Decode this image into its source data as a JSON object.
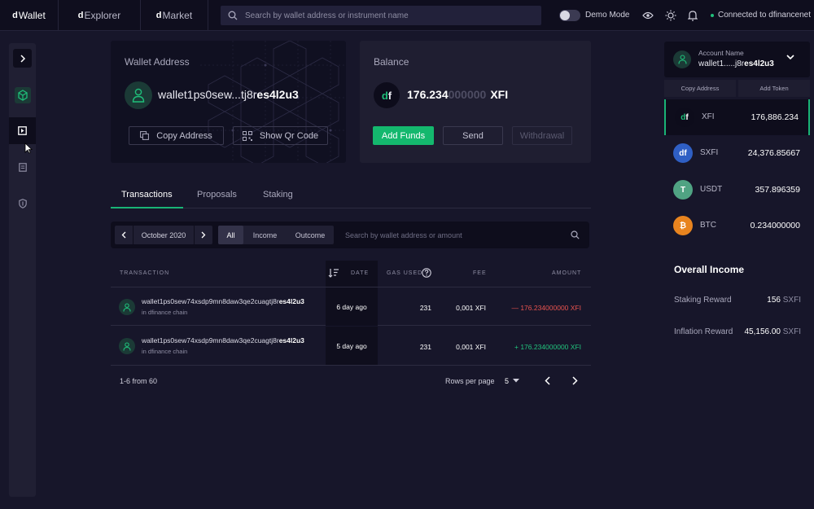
{
  "nav": {
    "tabs": [
      {
        "prefix": "d",
        "label": "Wallet"
      },
      {
        "prefix": "d",
        "label": "Explorer"
      },
      {
        "prefix": "d",
        "label": "Market"
      }
    ],
    "search_placeholder": "Search by wallet address or instrument name",
    "demo_mode_label": "Demo Mode",
    "demo_mode_on": false,
    "connection_label": "Connected to dfinancenet"
  },
  "wallet": {
    "title": "Wallet Address",
    "address_prefix": "wallet1ps0sew...tj8r",
    "address_suffix": "es4l2u3",
    "copy_label": "Copy Address",
    "qr_label": "Show Qr Code"
  },
  "balance": {
    "title": "Balance",
    "logo_d": "d",
    "logo_f": "f",
    "value_main": "176.234",
    "value_dim": "000000",
    "currency": "XFI",
    "add_funds": "Add Funds",
    "send": "Send",
    "withdrawal": "Withdrawal"
  },
  "tabs": [
    "Transactions",
    "Proposals",
    "Staking"
  ],
  "filter": {
    "month": "October 2020",
    "segments": [
      "All",
      "Income",
      "Outcome"
    ],
    "search_placeholder": "Search by wallet address or amount"
  },
  "table": {
    "headers": {
      "transaction": "TRANSACTION",
      "date": "DATE",
      "gas": "GAS USED",
      "fee": "FEE",
      "amount": "AMOUNT"
    },
    "rows": [
      {
        "addr": "wallet1ps0sew74xsdp9mn8daw3qe2cuagtj8r",
        "addr_bold": "es4l2u3",
        "chain": "in dfinance chain",
        "date": "6 day ago",
        "gas": "231",
        "fee": "0,001 XFI",
        "amount": "— 176.234000000 XFI",
        "type": "out"
      },
      {
        "addr": "wallet1ps0sew74xsdp9mn8daw3qe2cuagtj8r",
        "addr_bold": "es4l2u3",
        "chain": "in dfinance chain",
        "date": "5 day ago",
        "gas": "231",
        "fee": "0,001 XFI",
        "amount": "+ 176.234000000 XFI",
        "type": "in"
      }
    ]
  },
  "pager": {
    "count": "1-6 from 60",
    "rows_per_page_label": "Rows per page",
    "rows_per_page": "5"
  },
  "account": {
    "label": "Account Name",
    "value_prefix": "wallet1.....j8r",
    "value_suffix": "es4l2u3",
    "copy_address": "Copy Address",
    "add_token": "Add Token"
  },
  "tokens": [
    {
      "name": "XFI",
      "value": "176,886.234",
      "logo": "df",
      "color": "#0d0c1b"
    },
    {
      "name": "SXFI",
      "value": "24,376.85667",
      "logo": "df",
      "color": "#2f5fc4"
    },
    {
      "name": "USDT",
      "value": "357.896359",
      "logo": "T",
      "color": "#50a383"
    },
    {
      "name": "BTC",
      "value": "0.234000000",
      "logo": "₿",
      "color": "#e8841f"
    }
  ],
  "income": {
    "title": "Overall Income",
    "rows": [
      {
        "label": "Staking Reward",
        "value": "156",
        "unit": "SXFI"
      },
      {
        "label": "Inflation Reward",
        "value": "45,156.00",
        "unit": "SXFI"
      }
    ]
  },
  "colors": {
    "accent": "#19b476",
    "negative": "#e9534f",
    "positive": "#21c47d"
  }
}
